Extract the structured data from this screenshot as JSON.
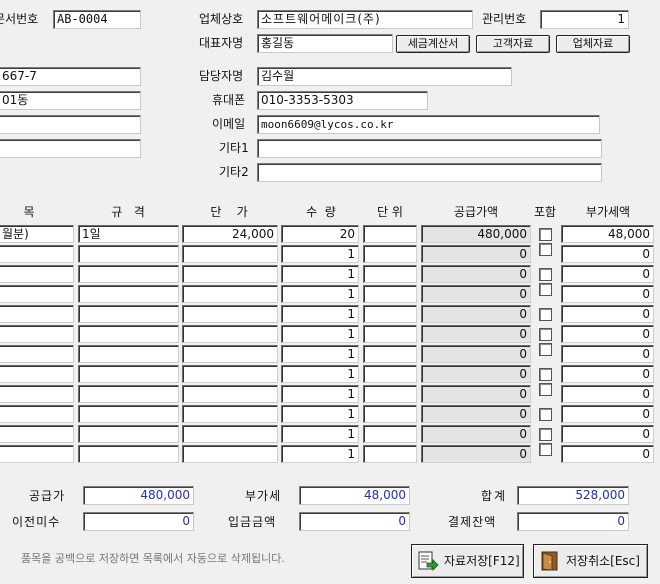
{
  "header": {
    "doc_no_label": "문서번호",
    "doc_no_value": "AB-0004",
    "company_label": "업체상호",
    "company_value": "소프트웨어메이크(주)",
    "manage_no_label": "관리번호",
    "manage_no_value": "1",
    "ceo_label": "대표자명",
    "ceo_value": "홍길동",
    "btn_tax_invoice": "세금계산서",
    "btn_customer": "고객자료",
    "btn_company": "업체자료"
  },
  "left_fields": [
    "667-7",
    "01동",
    "",
    ""
  ],
  "contact": {
    "manager_label": "담당자명",
    "manager_value": "김수월",
    "mobile_label": "휴대폰",
    "mobile_value": "010-3353-5303",
    "email_label": "이메일",
    "email_value": "moon6609@lycos.co.kr",
    "etc1_label": "기타1",
    "etc1_value": "",
    "etc2_label": "기타2",
    "etc2_value": ""
  },
  "columns": {
    "item": "목",
    "spec": "규   격",
    "unit_price": "단    가",
    "qty": "수  량",
    "unit": "단 위",
    "supply": "공급가액",
    "include": "포함",
    "vat": "부가세액"
  },
  "rows": [
    {
      "item": "월분)",
      "spec": "1일",
      "unit_price": "24,000",
      "qty": "20",
      "unit": "",
      "supply": "480,000",
      "vat": "48,000",
      "include": false
    },
    {
      "item": "",
      "spec": "",
      "unit_price": "",
      "qty": "1",
      "unit": "",
      "supply": "0",
      "vat": "0",
      "include": false
    },
    {
      "item": "",
      "spec": "",
      "unit_price": "",
      "qty": "1",
      "unit": "",
      "supply": "0",
      "vat": "0",
      "include": false
    },
    {
      "item": "",
      "spec": "",
      "unit_price": "",
      "qty": "1",
      "unit": "",
      "supply": "0",
      "vat": "0",
      "include": false
    },
    {
      "item": "",
      "spec": "",
      "unit_price": "",
      "qty": "1",
      "unit": "",
      "supply": "0",
      "vat": "0",
      "include": false
    },
    {
      "item": "",
      "spec": "",
      "unit_price": "",
      "qty": "1",
      "unit": "",
      "supply": "0",
      "vat": "0",
      "include": false
    },
    {
      "item": "",
      "spec": "",
      "unit_price": "",
      "qty": "1",
      "unit": "",
      "supply": "0",
      "vat": "0",
      "include": false
    },
    {
      "item": "",
      "spec": "",
      "unit_price": "",
      "qty": "1",
      "unit": "",
      "supply": "0",
      "vat": "0",
      "include": false
    },
    {
      "item": "",
      "spec": "",
      "unit_price": "",
      "qty": "1",
      "unit": "",
      "supply": "0",
      "vat": "0",
      "include": false
    },
    {
      "item": "",
      "spec": "",
      "unit_price": "",
      "qty": "1",
      "unit": "",
      "supply": "0",
      "vat": "0",
      "include": false
    },
    {
      "item": "",
      "spec": "",
      "unit_price": "",
      "qty": "1",
      "unit": "",
      "supply": "0",
      "vat": "0",
      "include": false
    },
    {
      "item": "",
      "spec": "",
      "unit_price": "",
      "qty": "1",
      "unit": "",
      "supply": "0",
      "vat": "0",
      "include": false
    }
  ],
  "totals": {
    "supply_label": "공급가",
    "supply_value": "480,000",
    "vat_label": "부가세",
    "vat_value": "48,000",
    "total_label": "합계",
    "total_value": "528,000",
    "prev_unpaid_label": "이전미수",
    "prev_unpaid_value": "0",
    "deposit_label": "입금금액",
    "deposit_value": "0",
    "balance_label": "결제잔액",
    "balance_value": "0"
  },
  "footer": {
    "note": "품목을 공백으로 저장하면 목록에서 자동으로 삭제됩니다.",
    "save_label": "자료저장[F12]",
    "cancel_label": "저장취소[Esc]",
    "save_icon": "save-document-icon",
    "cancel_icon": "exit-door-icon"
  },
  "colors": {
    "background": "#f0f0f0",
    "amount_text": "#1f2fbd"
  }
}
